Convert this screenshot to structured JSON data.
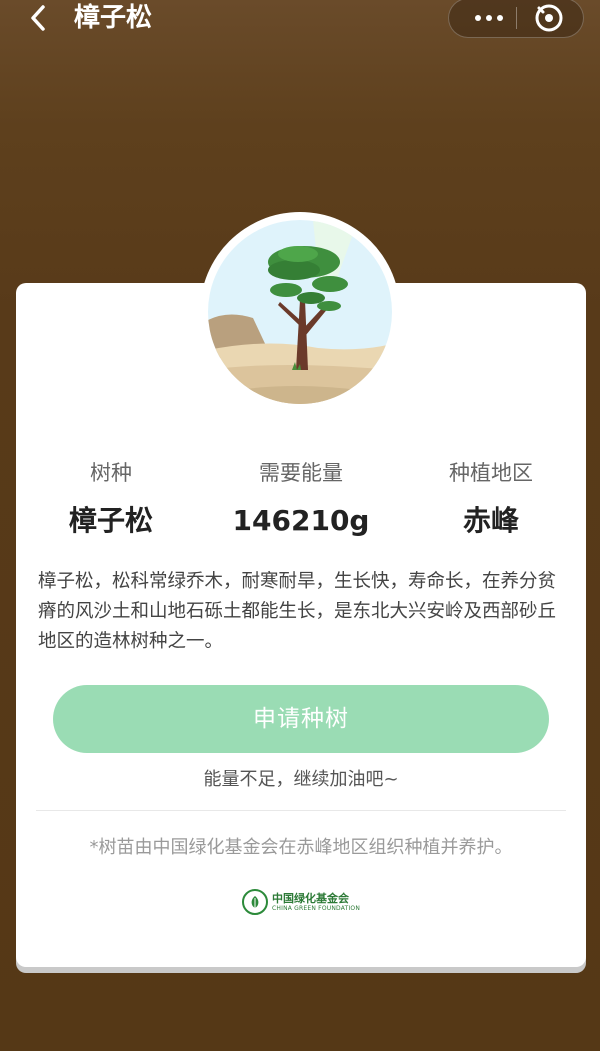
{
  "header": {
    "title": "樟子松"
  },
  "capsule": {
    "more_icon": "more-dots-icon",
    "close_icon": "close-target-icon"
  },
  "stats": [
    {
      "label": "树种",
      "value": "樟子松"
    },
    {
      "label": "需要能量",
      "value": "146210g"
    },
    {
      "label": "种植地区",
      "value": "赤峰"
    }
  ],
  "description": "樟子松，松科常绿乔木，耐寒耐旱，生长快，寿命长，在养分贫瘠的风沙土和山地石砾土都能生长，是东北大兴安岭及西部砂丘地区的造林树种之一。",
  "apply": {
    "label": "申请种树"
  },
  "hint": "能量不足，继续加油吧~",
  "note": "*树苗由中国绿化基金会在赤峰地区组织种植并养护。",
  "org": {
    "name_cn": "中国绿化基金会",
    "name_en": "CHINA GREEN FOUNDATION"
  },
  "colors": {
    "background": "#583a19",
    "button": "#9adcb4",
    "org_green": "#2c7a36"
  }
}
